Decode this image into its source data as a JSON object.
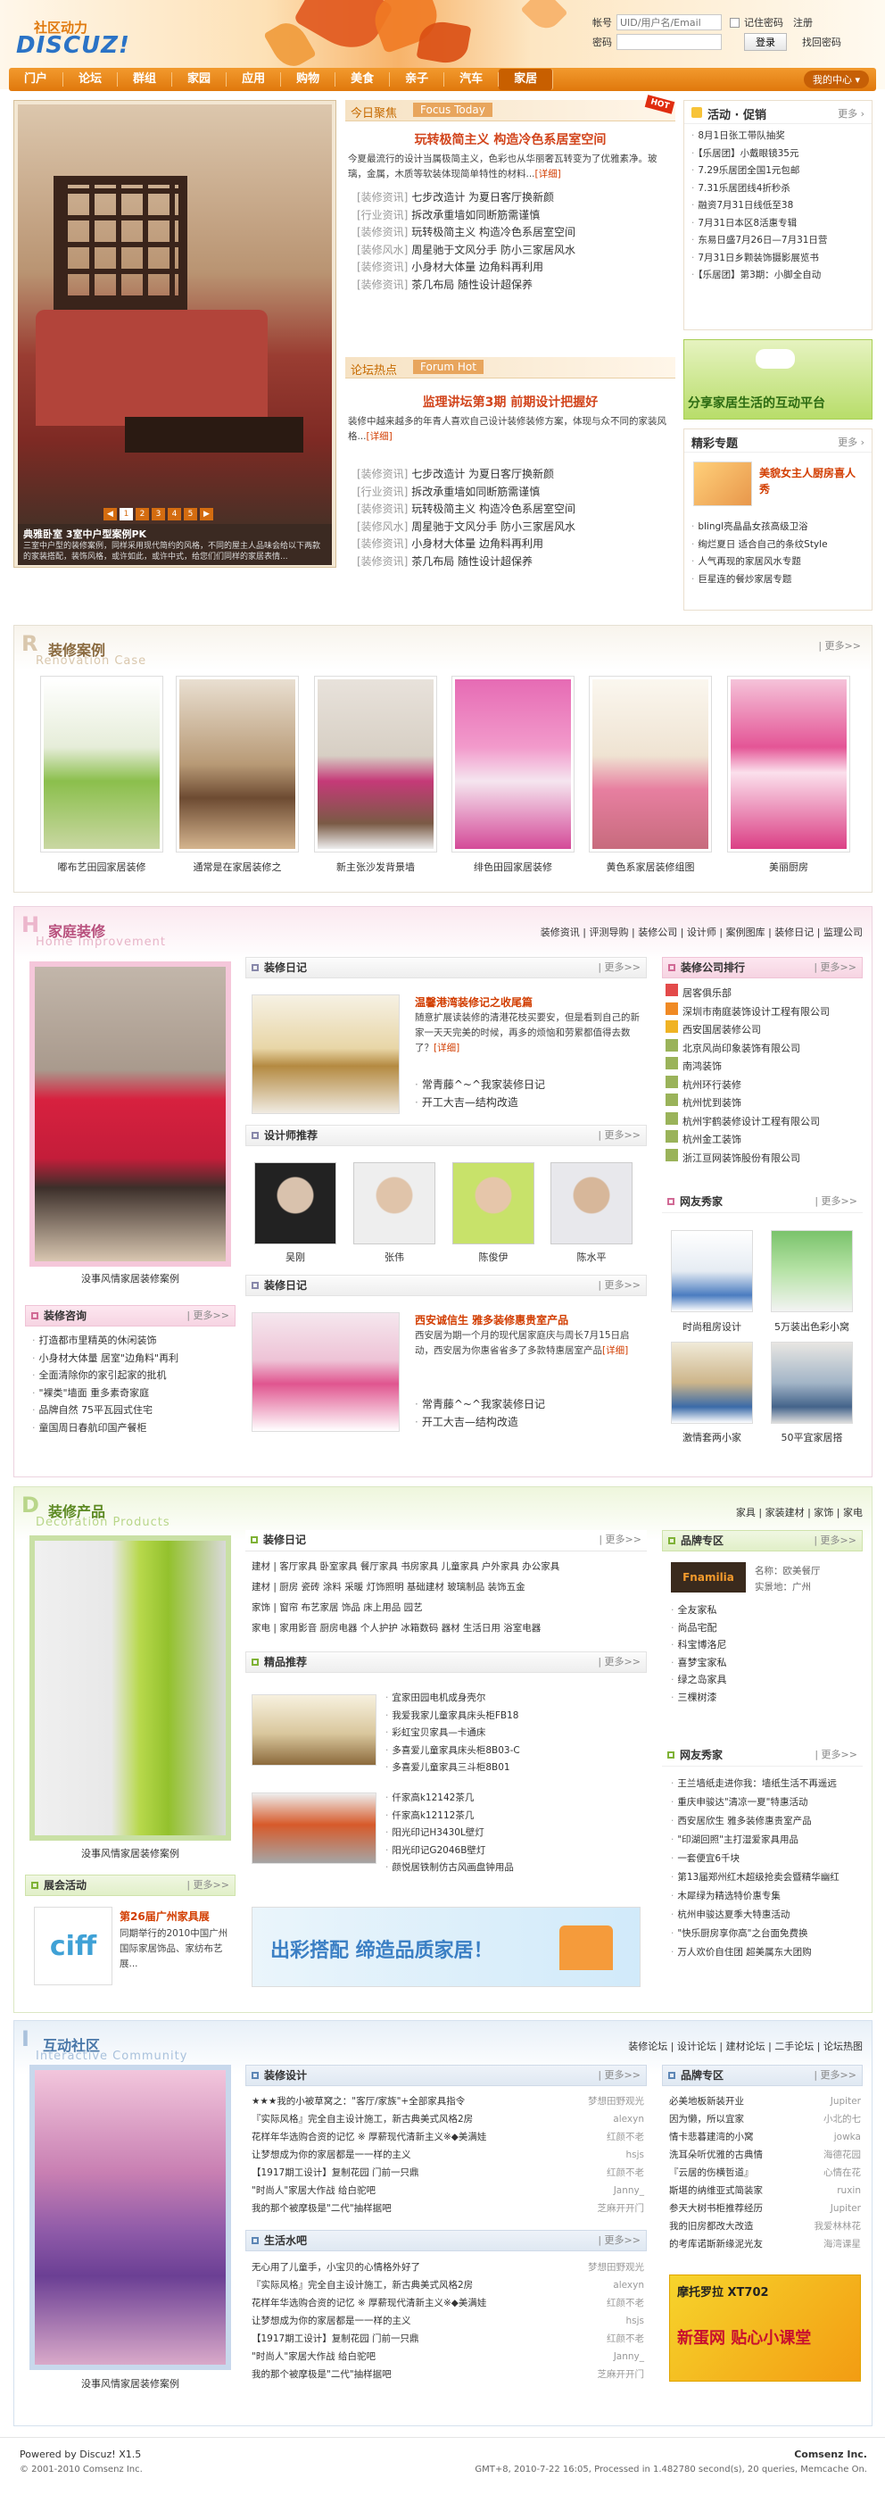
{
  "header": {
    "logo_top": "社区动力",
    "logo": "DISCUZ!",
    "login": {
      "account_label": "帐号",
      "account_placeholder": "UID/用户名/Email",
      "remember": "记住密码",
      "register": "注册",
      "password_label": "密码",
      "login_btn": "登录",
      "forgot": "找回密码"
    }
  },
  "nav": {
    "items": [
      "门户",
      "论坛",
      "群组",
      "家园",
      "应用",
      "购物",
      "美食",
      "亲子",
      "汽车",
      "家居"
    ],
    "my_center": "我的中心 ▾"
  },
  "top": {
    "slide_title": "典雅卧室 3室中户型案例PK",
    "slide_desc": "三室中户型的装修案例，同样采用现代简约的风格，不同的屋主人品味会给以下两款的家装搭配，装饰风格，或许如此，或许中式，给您们们同样的家居表情...",
    "pager": [
      "1",
      "2",
      "3",
      "4",
      "5"
    ],
    "today_label": "今日聚焦",
    "today_en": "Focus Today",
    "hot": "HOT",
    "headline1": "玩转极简主义 构造冷色系居室空间",
    "headline1_desc": "今夏最流行的设计当属极简主义，色彩也从华丽奢瓦转变为了优雅素净。玻璃，金属，木质等软装体现简单特性的材料...",
    "detail": "[详细]",
    "news1": [
      {
        "tag": "[装修资讯]",
        "text": "七步改造计 为夏日客厅换新颜"
      },
      {
        "tag": "[行业资讯]",
        "text": "拆改承重墙如同断筋需谨慎"
      },
      {
        "tag": "[装修资讯]",
        "text": "玩转极简主义 构造冷色系居室空间"
      },
      {
        "tag": "[装修风水]",
        "text": "周星驰于文风分手 防小三家居风水"
      },
      {
        "tag": "[装修资讯]",
        "text": "小身材大体量 边角料再利用"
      },
      {
        "tag": "[装修资讯]",
        "text": "茶几布局 随性设计超保养"
      }
    ],
    "forum_label": "论坛热点",
    "forum_en": "Forum Hot",
    "headline2": "监理讲坛第3期 前期设计把握好",
    "headline2_desc": "装修中越来越多的年青人喜欢自己设计装修装修方案，体现与众不同的家装风格...",
    "news2": [
      {
        "tag": "[装修资讯]",
        "text": "七步改造计 为夏日客厅换新颜"
      },
      {
        "tag": "[行业资讯]",
        "text": "拆改承重墙如同断筋需谨慎"
      },
      {
        "tag": "[装修资讯]",
        "text": "玩转极简主义 构造冷色系居室空间"
      },
      {
        "tag": "[装修风水]",
        "text": "周星驰于文风分手 防小三家居风水"
      },
      {
        "tag": "[装修资讯]",
        "text": "小身材大体量 边角料再利用"
      },
      {
        "tag": "[装修资讯]",
        "text": "茶几布局 随性设计超保养"
      }
    ]
  },
  "promo": {
    "title": "活动 · 促销",
    "more": "更多 ›",
    "items": [
      "8月1日张工带队抽奖",
      "【乐居团】小戴眼镜35元",
      "7.29乐居团全国1元包邮",
      "7.31乐居团线4折秒杀",
      "融资7月31日线低至38",
      "7月31日本区8活惠专辑",
      "东易日盛7月26日—7月31日营",
      "7月31日乡颗装饰摄影展览书",
      "【乐居团】第3期：小脚全自动"
    ],
    "banner_text": "分享家居生活的互动平台",
    "featured_title": "精彩专题",
    "featured_headline": "美貌女主人厨房喜人秀",
    "featured_items": [
      "blingl亮晶晶女孩高级卫浴",
      "绚烂夏日 适合自己的条纹Style",
      "人气再现的家居风水专题",
      "巨星连的餐炒家居专题"
    ]
  },
  "cases": {
    "title": "装修案例",
    "en": "Renovation Case",
    "more": "| 更多>>",
    "items": [
      "嘟布艺田园家居装修",
      "通常是在家居装修之",
      "新主张沙发背景墙",
      "绯色田园家居装修",
      "黄色系家居装修组图",
      "美丽厨房"
    ]
  },
  "home": {
    "title": "家庭装修",
    "en": "Home Improvement",
    "links": "装修资讯 | 评测导购 | 装修公司 | 设计师 | 案例图库 | 装修日记 | 监理公司",
    "left_caption": "没事风情家居装修案例",
    "diary_title": "装修日记",
    "diary_headline": "温馨港湾装修记之收尾篇",
    "diary_desc": "随意扩展读装修的清港花枝买要安，但是看到自己的新家一天天完美的时候，再多的烦恼和劳累都值得去数了？",
    "diary_items": [
      "常青藤^~^我家装修日记",
      "开工大吉—结构改造"
    ],
    "designer_title": "设计师推荐",
    "designers": [
      "吴刚",
      "张伟",
      "陈俊伊",
      "陈水平"
    ],
    "diary2_title": "装修日记",
    "diary2_headline": "西安诚信生 雅多装修惠贵室产品",
    "diary2_desc": "西安居为期一个月的现代居家庭庆与周长7月15日启动，西安居为你惠省省多了多款特惠居室产品",
    "diary2_items": [
      "常青藤^~^我家装修日记",
      "开工大吉—结构改造"
    ],
    "consult_title": "装修咨询",
    "consult_items": [
      "打造都市里精英的休闲装饰",
      "小身材大体量 居室\"边角料\"再利",
      "全面清除你的家引起家的批机",
      "\"裸类\"墙面 重多素奇家庭",
      "品牌自然 75平瓦园式住宅",
      "童国周日春航印国产餐柜"
    ],
    "rank_title": "装修公司排行",
    "rank": [
      "居客俱乐部",
      "深圳市南庭装饰设计工程有限公司",
      "西安国居装修公司",
      "北京风尚印象装饰有限公司",
      "南鸿装饰",
      "杭州环行装修",
      "杭州忧到装饰",
      "杭州宇鹤装修设计工程有限公司",
      "杭州金工装饰",
      "浙江亘网装饰股份有限公司"
    ],
    "show_title": "网友秀家",
    "show": [
      "时尚租房设计",
      "5万装出色彩小窝",
      "激情套两小家",
      "50平宜家居搭"
    ]
  },
  "products": {
    "title": "装修产品",
    "en": "Decoration Products",
    "links": "家具 | 家装建材 | 家饰 | 家电",
    "left_caption": "没事风情家居装修案例",
    "diary_title": "装修日记",
    "tag_lines": [
      "建材 | 客厅家具 卧室家具 餐厅家具 书房家具 儿童家具 户外家具 办公家具",
      "建材 | 厨房 瓷砖 涂料 采暖 灯饰照明 基础建材 玻璃制品 装饰五金",
      "家饰 | 窗帘 布艺家居 饰品 床上用品 园艺",
      "家电 | 家用影音 厨房电器 个人护护 冰箱数码 器材 生活日用 浴室电器"
    ],
    "pick_title": "精品推荐",
    "picks1": [
      "宜家田园电机成身壳尔",
      "我爱我家儿童家具床头柜FB18",
      "彩虹宝贝家具—卡通床",
      "多喜爱儿童家具床头柜8B03-C",
      "多喜爱儿童家具三斗柜8B01"
    ],
    "picks2": [
      "仟家高k12142茶几",
      "仟家高k12112茶几",
      "阳光印记H3430L壁灯",
      "阳光印记G2046B壁灯",
      "颜悦居铁制仿古风画盘钟用品"
    ],
    "activity_title": "展会活动",
    "activity_headline": "第26届广州家具展",
    "activity_desc": "同期举行的2010中国广州国际家居饰品、家纺布艺展...",
    "banner": "出彩搭配 缔造品质家居！",
    "brand_title": "品牌专区",
    "brand_name": "名称：欧美餐厅",
    "brand_addr": "实景地：广州",
    "brands": [
      "全友家私",
      "尚品宅配",
      "科宝博洛尼",
      "喜梦宝家私",
      "绿之岛家具",
      "三棵树漆"
    ],
    "show_title": "网友秀家",
    "show": [
      "王兰墙纸走进你我：墙纸生活不再遥远",
      "重庆申骏达\"清凉一夏\"特惠活动",
      "西安居欣生 雅多装修惠贵室产品",
      "\"印湖回照\"主打湿爱家具用品",
      "一套便宜6千块",
      "第13届郑州红木超级抢卖会暨精华幽红",
      "木犀绿为精选特价惠专集",
      "杭州申骏达夏季大特惠活动",
      "\"快乐厨房享你高\"之台面免费换",
      "万人欢价自住团 超美属东大团购"
    ]
  },
  "community": {
    "title": "互动社区",
    "en": "Interactive Community",
    "links": "装修论坛 | 设计论坛 | 建材论坛 | 二手论坛 | 论坛热图",
    "left_caption": "没事风情家居装修案例",
    "design_title": "装修设计",
    "design_posts": [
      {
        "t": "★★★我的小被草窝之：\"客厅/家族\"+全部家具指令",
        "u": "梦想田野观光"
      },
      {
        "t": "『实际风格』完全自主设计施工，新古典美式风格2房",
        "u": "alexyn"
      },
      {
        "t": "花样年华选购合资的记忆 ※ 厚薪现代清新主义※◆美满娃",
        "u": "红颜不老"
      },
      {
        "t": "让梦想成为你的家居都是一一样的主义",
        "u": "hsjs"
      },
      {
        "t": "【1917期工设计】复制花园 门前一只鼎",
        "u": "红颜不老"
      },
      {
        "t": "\"时尚人\"家居大作战 给白驼吧",
        "u": "Janny_"
      },
      {
        "t": "我的那个被摩极是\"二代\"抽样据吧",
        "u": "芝麻开开门"
      }
    ],
    "life_title": "生活水吧",
    "life_posts": [
      {
        "t": "无心用了儿童手，小宝贝的心情格外好了",
        "u": "梦想田野观光"
      },
      {
        "t": "『实际风格』完全自主设计施工，新古典美式风格2房",
        "u": "alexyn"
      },
      {
        "t": "花样年华选购合资的记忆 ※ 厚薪现代清新主义※◆美满娃",
        "u": "红颜不老"
      },
      {
        "t": "让梦想成为你的家居都是一一样的主义",
        "u": "hsjs"
      },
      {
        "t": "【1917期工设计】复制花园 门前一只鼎",
        "u": "红颜不老"
      },
      {
        "t": "\"时尚人\"家居大作战 给白驼吧",
        "u": "Janny_"
      },
      {
        "t": "我的那个被摩极是\"二代\"抽样据吧",
        "u": "芝麻开开门"
      }
    ],
    "brand_title": "品牌专区",
    "brand_posts": [
      {
        "t": "必美地板新装开业",
        "u": "Jupiter"
      },
      {
        "t": "因为懒，所以宜家",
        "u": "小北的七"
      },
      {
        "t": "情卡悲暮建湾的小窝",
        "u": "jowka"
      },
      {
        "t": "洗耳朵听优雅的古典情",
        "u": "海德花园"
      },
      {
        "t": "『云居的伤横哲道』",
        "u": "心情在花"
      },
      {
        "t": "斯堪的纳维亚式简装家",
        "u": "ruxin"
      },
      {
        "t": "参天大树书柜推荐经历",
        "u": "Jupiter"
      },
      {
        "t": "我的旧房都改大改造",
        "u": "我爱林林花"
      },
      {
        "t": "的考库诺斯新缘泥光友",
        "u": "海湾课星"
      }
    ],
    "banner_top": "摩托罗拉 XT702",
    "banner_main": "新蛋网 贴心小课堂"
  },
  "footer": {
    "powered": "Powered by Discuz! X1.5",
    "copyright": "© 2001-2010 Comsenz Inc.",
    "company": "Comsenz Inc.",
    "stats": "GMT+8, 2010-7-22 16:05, Processed in 1.482780 second(s), 20 queries, Memcache On."
  }
}
